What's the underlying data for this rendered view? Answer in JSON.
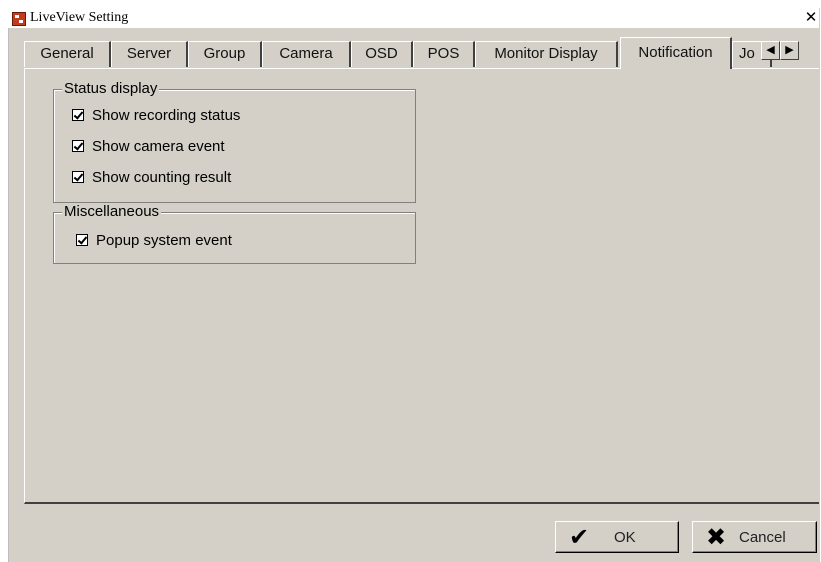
{
  "window": {
    "title": "LiveView Setting",
    "close_glyph": "✕"
  },
  "tabs": [
    {
      "label": "General"
    },
    {
      "label": "Server"
    },
    {
      "label": "Group"
    },
    {
      "label": "Camera"
    },
    {
      "label": "OSD"
    },
    {
      "label": "POS"
    },
    {
      "label": "Monitor Display"
    },
    {
      "label": "Notification",
      "active": true
    },
    {
      "label": "Jo"
    }
  ],
  "tab_scroll": {
    "left_glyph": "◀",
    "right_glyph": "▶"
  },
  "status_display": {
    "legend": "Status display",
    "items": [
      {
        "label": "Show recording status",
        "checked": true
      },
      {
        "label": "Show camera event",
        "checked": true
      },
      {
        "label": "Show counting result",
        "checked": true
      }
    ]
  },
  "miscellaneous": {
    "legend": "Miscellaneous",
    "items": [
      {
        "label": "Popup system event",
        "checked": true
      }
    ]
  },
  "buttons": {
    "ok": {
      "label": "OK",
      "icon": "check-icon",
      "glyph": "✔"
    },
    "cancel": {
      "label": "Cancel",
      "icon": "x-icon",
      "glyph": "✖"
    }
  }
}
